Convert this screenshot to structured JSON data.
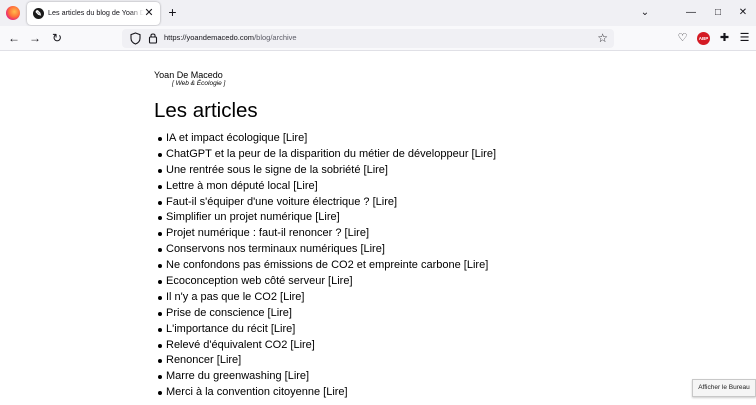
{
  "browser": {
    "tab": {
      "title": "Les articles du blog de Yoan De Macedo",
      "favicon": "🌍"
    },
    "new_tab": "+",
    "window": {
      "minimize": "—",
      "maximize": "□",
      "close": "✕"
    },
    "url": {
      "host": "https://yoandemacedo.com",
      "path": "/blog/archive"
    },
    "abp_label": "ABP"
  },
  "page": {
    "site_name": "Yoan De Macedo",
    "tagline": "[ Web & Écologie ]",
    "title": "Les articles",
    "read_label": "[Lire]",
    "articles": [
      "IA et impact écologique",
      "ChatGPT et la peur de la disparition du métier de développeur",
      "Une rentrée sous le signe de la sobriété",
      "Lettre à mon député local",
      "Faut-il s'équiper d'une voiture électrique ?",
      "Simplifier un projet numérique",
      "Projet numérique : faut-il renoncer ?",
      "Conservons nos terminaux numériques",
      "Ne confondons pas émissions de CO2 et empreinte carbone",
      "Ecoconception web côté serveur",
      "Il n'y a pas que le CO2",
      "Prise de conscience",
      "L'importance du récit",
      "Relevé d'équivalent CO2",
      "Renoncer",
      "Marre du greenwashing",
      "Merci à la convention citoyenne"
    ]
  },
  "taskbar_tooltip": "Afficher le Bureau"
}
